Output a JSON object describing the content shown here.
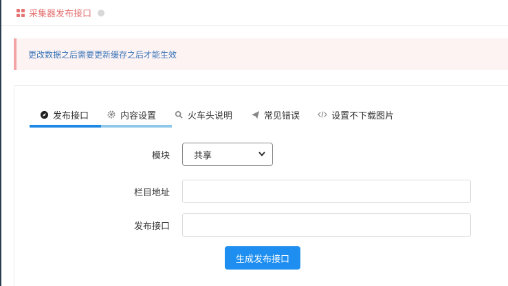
{
  "header": {
    "title": "采集器发布接口",
    "icon": "grid-icon",
    "status_icon": "status-dot-icon"
  },
  "notice": {
    "text": "更改数据之后需要更新缓存之后才能生效"
  },
  "tabs": [
    {
      "label": "发布接口",
      "icon": "compass-icon"
    },
    {
      "label": "内容设置",
      "icon": "gear-icon"
    },
    {
      "label": "火车头说明",
      "icon": "search-icon"
    },
    {
      "label": "常见错误",
      "icon": "paper-plane-icon"
    },
    {
      "label": "设置不下载图片",
      "icon": "code-icon"
    }
  ],
  "form": {
    "module_label": "模块",
    "module_value": "共享",
    "column_label": "栏目地址",
    "column_value": "",
    "api_label": "发布接口",
    "api_value": "",
    "submit_label": "生成发布接口"
  },
  "colors": {
    "accent": "#1e8ff0",
    "tab_active": "#1e88e5",
    "tab_secondary": "#90c8ea",
    "header_title": "#e57373",
    "notice_text": "#3a76b8",
    "notice_border": "#f3a5a5"
  }
}
